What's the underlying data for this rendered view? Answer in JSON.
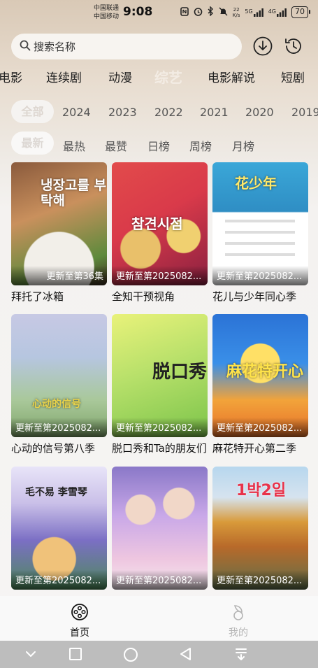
{
  "status": {
    "carrier1": "中国联通",
    "carrier2": "中国移动",
    "time": "9:08",
    "speed_value": "22",
    "speed_unit": "K/s",
    "net1": "5G",
    "net2": "4G",
    "battery": "70"
  },
  "search": {
    "placeholder": "搜索名称"
  },
  "categories": [
    "电影",
    "连续剧",
    "动漫",
    "综艺",
    "电影解说",
    "短剧"
  ],
  "active_category": "综艺",
  "years": {
    "all": "全部",
    "list": [
      "2024",
      "2023",
      "2022",
      "2021",
      "2020",
      "2019"
    ]
  },
  "sort": {
    "active": "最新",
    "list": [
      "最热",
      "最赞",
      "日榜",
      "周榜",
      "月榜"
    ]
  },
  "shows": [
    {
      "title": "拜托了冰箱",
      "badge": "更新至第36集",
      "poster_text": "냉장고를 부탁해"
    },
    {
      "title": "全知干预视角",
      "badge": "更新至第2025082...",
      "poster_text": "참견시점"
    },
    {
      "title": "花儿与少年同心季",
      "badge": "更新至第2025082...",
      "poster_text": "花少年"
    },
    {
      "title": "心动的信号第八季",
      "badge": "更新至第2025082...",
      "poster_text": "心动的信号"
    },
    {
      "title": "脱口秀和Ta的朋友们",
      "badge": "更新至第2025082...",
      "poster_text": "脱口秀"
    },
    {
      "title": "麻花特开心第二季",
      "badge": "更新至第2025082...",
      "poster_text": "麻花特开心"
    },
    {
      "title": "毛不易 李雪琴",
      "badge": "更新至第2025082...",
      "poster_text": "毛不易 李雪琴"
    },
    {
      "title": "",
      "badge": "更新至第2025082...",
      "poster_text": ""
    },
    {
      "title": "",
      "badge": "更新至第2025082...",
      "poster_text": "1박2일"
    }
  ],
  "bottom_nav": {
    "home": "首页",
    "mine": "我的"
  },
  "colors": {
    "accent": "#111111",
    "inactive": "#b5b5b5"
  }
}
